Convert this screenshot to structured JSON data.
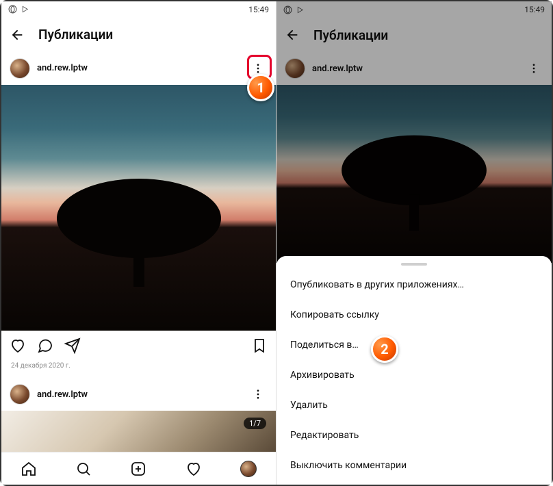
{
  "status": {
    "time": "15:49",
    "opera_icon": "opera-icon",
    "play_icon": "play-icon"
  },
  "header": {
    "title": "Публикации"
  },
  "post": {
    "username": "and.rew.lptw",
    "date": "24 декабря 2020 г."
  },
  "post2": {
    "username": "and.rew.lptw",
    "carousel": "1/7"
  },
  "sheet": {
    "items": [
      "Опубликовать в других приложениях…",
      "Копировать ссылку",
      "Поделиться в…",
      "Архивировать",
      "Удалить",
      "Редактировать",
      "Выключить комментарии"
    ]
  },
  "badges": {
    "one": "1",
    "two": "2"
  }
}
